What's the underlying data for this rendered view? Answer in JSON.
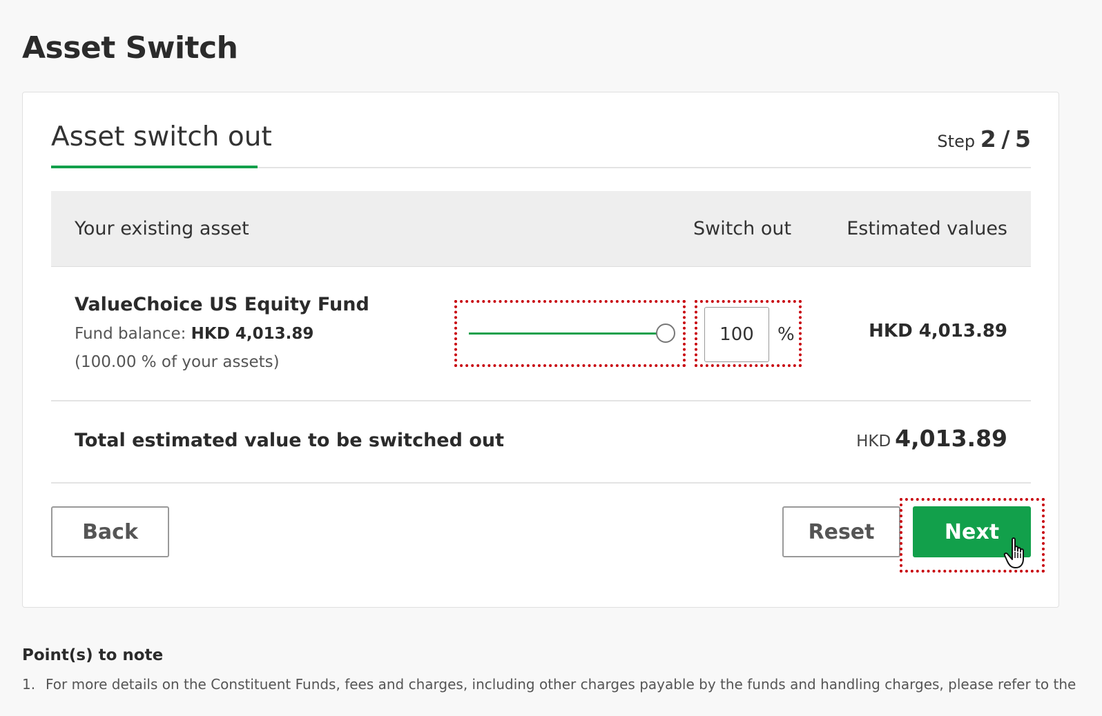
{
  "page": {
    "title": "Asset Switch"
  },
  "card": {
    "title": "Asset switch out",
    "step_label": "Step",
    "step_current": "2",
    "step_separator": "/",
    "step_total": "5"
  },
  "table": {
    "headers": {
      "asset": "Your existing asset",
      "switch_out": "Switch out",
      "estimated": "Estimated values"
    },
    "rows": [
      {
        "fund_name": "ValueChoice US Equity Fund",
        "balance_label": "Fund balance:",
        "balance_value": "HKD 4,013.89",
        "percent_of_assets": "(100.00 % of your assets)",
        "switch_out_percent": "100",
        "slider_level": 1.0,
        "percent_sign": "%",
        "estimated_value": "HKD 4,013.89"
      }
    ],
    "total": {
      "label": "Total estimated value to be switched out",
      "currency": "HKD",
      "amount": "4,013.89"
    }
  },
  "buttons": {
    "back": "Back",
    "reset": "Reset",
    "next": "Next"
  },
  "notes": {
    "title": "Point(s) to note",
    "items": [
      {
        "number": "1.",
        "text": "For more details on the Constituent Funds, fees and charges, including other charges payable by the funds and handling charges, please refer to the"
      }
    ]
  },
  "colors": {
    "accent": "#12a04b",
    "highlight": "#c8000a",
    "header_bg": "#eeeeee",
    "page_bg": "#f8f8f8"
  },
  "icons": {
    "cursor": "hand-pointer-icon"
  }
}
